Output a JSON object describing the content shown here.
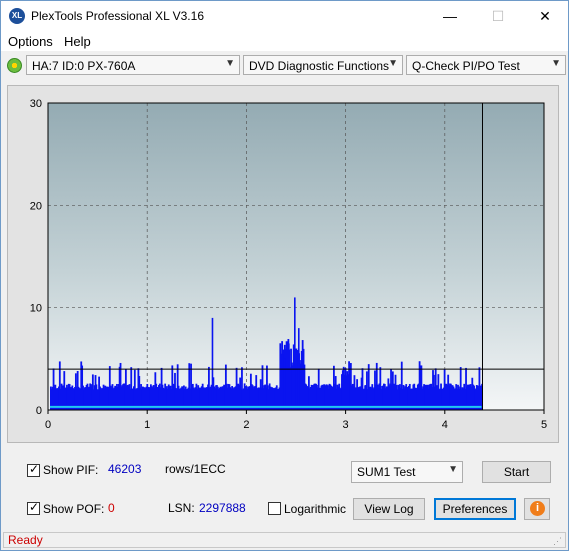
{
  "window": {
    "title": "PlexTools Professional XL V3.16",
    "icon_label": "XL",
    "controls": {
      "minimize": "—",
      "maximize": "☐",
      "close": "✕"
    }
  },
  "menu": {
    "options": "Options",
    "help": "Help"
  },
  "toolbar": {
    "drive": "HA:7 ID:0  PX-760A",
    "function": "DVD Diagnostic Functions",
    "test": "Q-Check PI/PO Test"
  },
  "chart_data": {
    "type": "bar",
    "x_ticks": [
      "0",
      "1",
      "2",
      "3",
      "4",
      "5"
    ],
    "y_ticks": [
      "0",
      "10",
      "20",
      "30"
    ],
    "xlim": [
      0,
      5
    ],
    "ylim": [
      0,
      30
    ],
    "grid": true,
    "threshold_line": 4,
    "end_marker_x": 4.38,
    "series": [
      {
        "color": "#0a14f0",
        "segments": [
          {
            "x0": 0.02,
            "x1": 4.37,
            "base": 2,
            "note": "PI baseline"
          },
          {
            "x": 1.65,
            "v": 9
          },
          {
            "x": 2.42,
            "v": 6.5
          },
          {
            "x": 2.48,
            "v": 11
          },
          {
            "x": 2.52,
            "v": 8
          },
          {
            "x": 2.38,
            "v": 5
          }
        ]
      },
      {
        "color": "#20c8f0",
        "values_note": "PIF/POF low trace",
        "level": 0.3
      }
    ]
  },
  "bottom": {
    "show_pif_label": "Show PIF:",
    "pif_value": "46203",
    "rows_label": "rows/1ECC",
    "show_pof_label": "Show POF:",
    "pof_value": "0",
    "lsn_label": "LSN:",
    "lsn_value": "2297888",
    "logarithmic_label": "Logarithmic",
    "sum_select": "SUM1 Test",
    "start_label": "Start",
    "view_log_label": "View Log",
    "preferences_label": "Preferences",
    "info_label": "i"
  },
  "status": {
    "text": "Ready"
  },
  "colors": {
    "pif_value": "#0000c0",
    "pof_value": "#cc0000",
    "lsn_value": "#0000c0",
    "status": "#cc0000"
  }
}
